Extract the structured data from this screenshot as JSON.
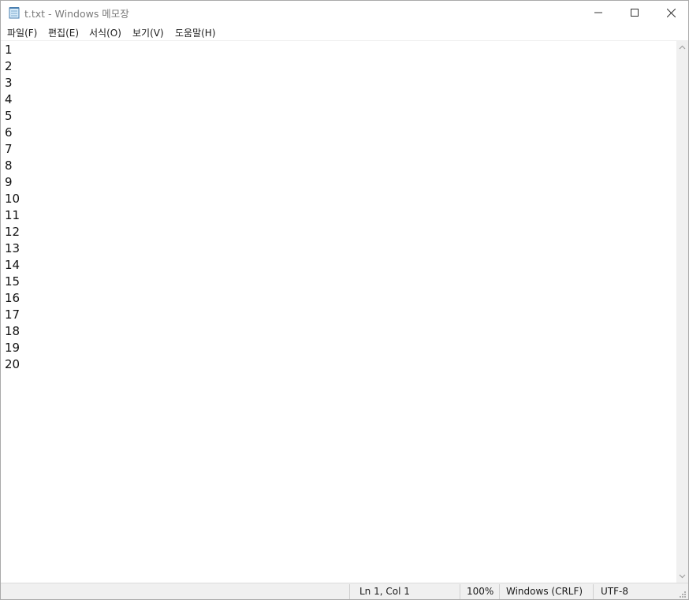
{
  "window": {
    "title": "t.txt - Windows 메모장",
    "app_icon": "notepad-icon",
    "controls": {
      "minimize_icon": "minimize-icon",
      "maximize_icon": "maximize-icon",
      "close_icon": "close-icon"
    }
  },
  "menu": {
    "items": [
      {
        "label": "파일(F)"
      },
      {
        "label": "편집(E)"
      },
      {
        "label": "서식(O)"
      },
      {
        "label": "보기(V)"
      },
      {
        "label": "도움말(H)"
      }
    ]
  },
  "editor": {
    "lines": [
      "1",
      "2",
      "3",
      "4",
      "5",
      "6",
      "7",
      "8",
      "9",
      "10",
      "11",
      "12",
      "13",
      "14",
      "15",
      "16",
      "17",
      "18",
      "19",
      "20"
    ]
  },
  "statusbar": {
    "position": "Ln 1, Col 1",
    "zoom": "100%",
    "line_ending": "Windows (CRLF)",
    "encoding": "UTF-8"
  }
}
